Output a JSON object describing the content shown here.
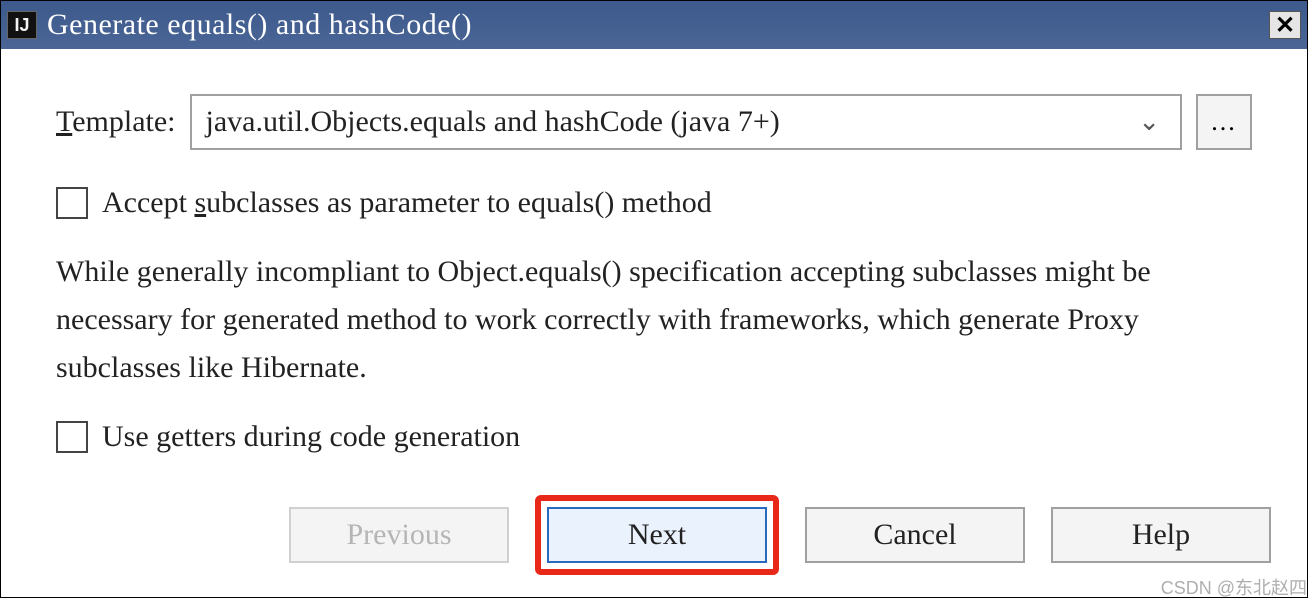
{
  "titlebar": {
    "app_icon_text": "IJ",
    "title": "Generate equals() and hashCode()",
    "close_glyph": "✕"
  },
  "template_row": {
    "label_prefix": "T",
    "label_rest": "emplate:",
    "selected_value": "java.util.Objects.equals and hashCode (java 7+)",
    "chevron": "⌄",
    "ellipsis": "..."
  },
  "checkbox1": {
    "prefix": "Accept ",
    "underline": "s",
    "rest": "ubclasses as parameter to equals() method"
  },
  "description": "While generally incompliant to Object.equals() specification accepting subclasses might be necessary for generated method to work correctly with frameworks, which generate Proxy subclasses like Hibernate.",
  "checkbox2": {
    "label": "Use getters during code generation"
  },
  "buttons": {
    "previous": "Previous",
    "next": "Next",
    "cancel": "Cancel",
    "help": "Help"
  },
  "watermark": "CSDN @东北赵四"
}
